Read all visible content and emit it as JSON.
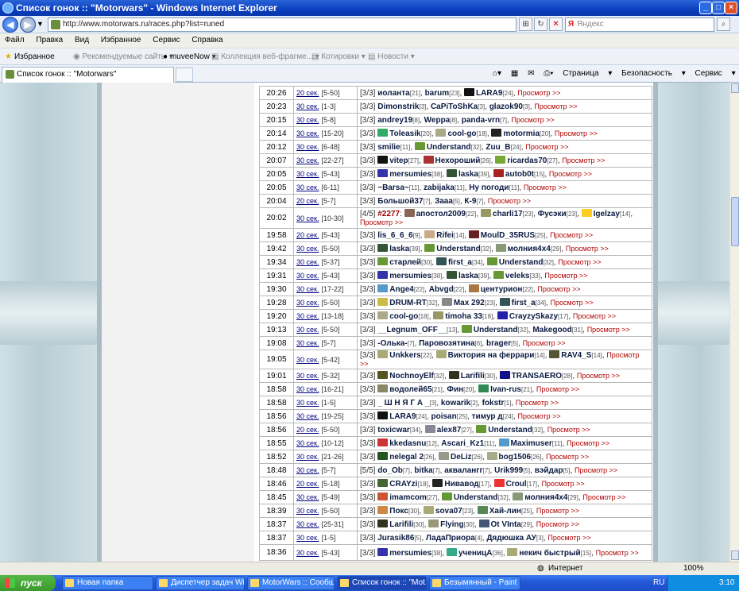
{
  "window": {
    "title": "Список гонок :: \"Motorwars\" - Windows Internet Explorer"
  },
  "address": {
    "url": "http://www.motorwars.ru/races.php?list=runed",
    "search_placeholder": "Яндекс"
  },
  "menu": [
    "Файл",
    "Правка",
    "Вид",
    "Избранное",
    "Сервис",
    "Справка"
  ],
  "favorites": {
    "label": "Избранное",
    "items": [
      "Рекомендуемые сайты",
      "muveeNow",
      "Коллекция веб-фрагме...",
      "Котировки",
      "Новости"
    ]
  },
  "tab": {
    "title": "Список гонок :: \"Motorwars\""
  },
  "commands": [
    "Страница",
    "Безопасность",
    "Сервис"
  ],
  "races": [
    {
      "t": "20:26",
      "d": "20 сек.",
      "r": "[5-50]",
      "p": [
        [
          "иоланта",
          "21",
          ""
        ],
        [
          "barum",
          "23",
          ""
        ],
        [
          "LARA9",
          "24",
          "#111"
        ]
      ]
    },
    {
      "t": "20:23",
      "d": "30 сек.",
      "r": "[1-3]",
      "p": [
        [
          "Dimonstrik",
          "3",
          ""
        ],
        [
          "CaPiToShKa",
          "3",
          ""
        ],
        [
          "glazok90",
          "3",
          ""
        ]
      ]
    },
    {
      "t": "20:15",
      "d": "30 сек.",
      "r": "[5-8]",
      "p": [
        [
          "andrey19",
          "8",
          ""
        ],
        [
          "Weppa",
          "8",
          ""
        ],
        [
          "panda-vrn",
          "7",
          ""
        ]
      ]
    },
    {
      "t": "20:14",
      "d": "30 сек.",
      "r": "[15-20]",
      "p": [
        [
          "Toleasik",
          "20",
          "#3a6"
        ],
        [
          "cool-go",
          "18",
          "#aa8"
        ],
        [
          "motormia",
          "20",
          "#222"
        ]
      ]
    },
    {
      "t": "20:12",
      "d": "30 сек.",
      "r": "[6-48]",
      "p": [
        [
          "smilie",
          "11",
          ""
        ],
        [
          "Understand",
          "32",
          "#693"
        ],
        [
          "Zuu_B",
          "24",
          ""
        ]
      ]
    },
    {
      "t": "20:07",
      "d": "30 сек.",
      "r": "[22-27]",
      "p": [
        [
          "vitep",
          "27",
          "#111"
        ],
        [
          "Нехороший",
          "26",
          "#a33"
        ],
        [
          "ricardas70",
          "27",
          "#7a3"
        ]
      ]
    },
    {
      "t": "20:05",
      "d": "30 сек.",
      "r": "[5-43]",
      "p": [
        [
          "mersumies",
          "38",
          "#33a"
        ],
        [
          "laska",
          "39",
          "#353"
        ],
        [
          "autob0t",
          "15",
          "#a22"
        ]
      ]
    },
    {
      "t": "20:05",
      "d": "30 сек.",
      "r": "[6-11]",
      "p": [
        [
          "~Barsa~",
          "11",
          ""
        ],
        [
          "zabijaka",
          "11",
          ""
        ],
        [
          "Ну погоди",
          "11",
          ""
        ]
      ]
    },
    {
      "t": "20:04",
      "d": "20 сек.",
      "r": "[5-7]",
      "p": [
        [
          "Большой37",
          "7",
          ""
        ],
        [
          "Зааа",
          "5",
          ""
        ],
        [
          "К-9",
          "7",
          ""
        ]
      ]
    },
    {
      "t": "20:02",
      "d": "30 сек.",
      "r": "[10-30]",
      "x": "#2277",
      "q": "[4/5]",
      "p": [
        [
          "апостол2009",
          "22",
          "#865"
        ],
        [
          "charli17",
          "23",
          "#996"
        ],
        [
          "Фусэки",
          "23",
          ""
        ],
        [
          "Igelzay",
          "14",
          "#fc2"
        ]
      ]
    },
    {
      "t": "19:58",
      "d": "20 сек.",
      "r": "[5-43]",
      "p": [
        [
          "lis_6_6_6",
          "9",
          ""
        ],
        [
          "Rifei",
          "14",
          "#ca8"
        ],
        [
          "MoulD_35RUS",
          "25",
          "#622"
        ]
      ]
    },
    {
      "t": "19:42",
      "d": "30 сек.",
      "r": "[5-50]",
      "p": [
        [
          "laska",
          "39",
          "#353"
        ],
        [
          "Understand",
          "32",
          "#693"
        ],
        [
          "молния4х4",
          "29",
          "#897"
        ]
      ]
    },
    {
      "t": "19:34",
      "d": "30 сек.",
      "r": "[5-37]",
      "p": [
        [
          "старлей",
          "30",
          "#693"
        ],
        [
          "first_a",
          "34",
          "#355"
        ],
        [
          "Understand",
          "32",
          "#693"
        ]
      ]
    },
    {
      "t": "19:31",
      "d": "30 сек.",
      "r": "[5-43]",
      "p": [
        [
          "mersumies",
          "38",
          "#33a"
        ],
        [
          "laska",
          "39",
          "#353"
        ],
        [
          "veleks",
          "33",
          "#693"
        ]
      ]
    },
    {
      "t": "19:30",
      "d": "30 сек.",
      "r": "[17-22]",
      "p": [
        [
          "Ange4",
          "22",
          "#59c"
        ],
        [
          "Abvgd",
          "22",
          ""
        ],
        [
          "центурион",
          "22",
          "#a74"
        ]
      ]
    },
    {
      "t": "19:28",
      "d": "30 сек.",
      "r": "[5-50]",
      "p": [
        [
          "DRUM-RT",
          "32",
          "#cb4"
        ],
        [
          "Max 292",
          "23",
          "#888"
        ],
        [
          "first_a",
          "34",
          "#355"
        ]
      ]
    },
    {
      "t": "19:20",
      "d": "30 сек.",
      "r": "[13-18]",
      "p": [
        [
          "cool-go",
          "18",
          "#aa8"
        ],
        [
          "timoha 33",
          "18",
          "#996"
        ],
        [
          "CrayzySkazy",
          "17",
          "#22a"
        ]
      ]
    },
    {
      "t": "19:13",
      "d": "30 сек.",
      "r": "[5-50]",
      "p": [
        [
          "__Legnum_OFF__",
          "13",
          ""
        ],
        [
          "Understand",
          "32",
          "#693"
        ],
        [
          "Makegood",
          "31",
          ""
        ]
      ]
    },
    {
      "t": "19:08",
      "d": "30 сек.",
      "r": "[5-7]",
      "p": [
        [
          "-Олька-",
          "7",
          ""
        ],
        [
          "Паровозятина",
          "6",
          ""
        ],
        [
          "brager",
          "5",
          ""
        ]
      ]
    },
    {
      "t": "19:05",
      "d": "30 сек.",
      "r": "[5-42]",
      "p": [
        [
          "Unkkers",
          "22",
          "#aa7"
        ],
        [
          "Виктория на феррари",
          "14",
          "#aa7"
        ],
        [
          "RAV4_S",
          "14",
          "#553"
        ]
      ]
    },
    {
      "t": "19:01",
      "d": "30 сек.",
      "r": "[5-32]",
      "p": [
        [
          "NochnoyElf",
          "32",
          "#552"
        ],
        [
          "Larifili",
          "30",
          "#332"
        ],
        [
          "TRANSAERO",
          "28",
          "#118"
        ]
      ]
    },
    {
      "t": "18:58",
      "d": "30 сек.",
      "r": "[16-21]",
      "p": [
        [
          "водолей65",
          "21",
          "#886"
        ],
        [
          "Фин",
          "20",
          ""
        ],
        [
          "Ivan-rus",
          "21",
          "#385"
        ]
      ]
    },
    {
      "t": "18:58",
      "d": "30 сек.",
      "r": "[1-5]",
      "p": [
        [
          "_ Ш Н Я Г А _",
          "3",
          ""
        ],
        [
          "kowarik",
          "2",
          ""
        ],
        [
          "fokstr",
          "1",
          ""
        ]
      ]
    },
    {
      "t": "18:56",
      "d": "30 сек.",
      "r": "[19-25]",
      "p": [
        [
          "LARA9",
          "24",
          "#111"
        ],
        [
          "poisan",
          "25",
          ""
        ],
        [
          "тимур д",
          "24",
          ""
        ]
      ]
    },
    {
      "t": "18:56",
      "d": "20 сек.",
      "r": "[5-50]",
      "p": [
        [
          "toxicwar",
          "34",
          ""
        ],
        [
          "alex87",
          "27",
          "#889"
        ],
        [
          "Understand",
          "32",
          "#693"
        ]
      ]
    },
    {
      "t": "18:55",
      "d": "30 сек.",
      "r": "[10-12]",
      "p": [
        [
          "kkedasnu",
          "12",
          "#c33"
        ],
        [
          "Ascari_Kz1",
          "11",
          ""
        ],
        [
          "Maximuser",
          "11",
          "#59c"
        ]
      ]
    },
    {
      "t": "18:52",
      "d": "30 сек.",
      "r": "[21-26]",
      "p": [
        [
          "nelegal 2",
          "26",
          "#252"
        ],
        [
          "DeLiz",
          "26",
          "#998"
        ],
        [
          "bog1506",
          "26",
          "#aa8"
        ]
      ]
    },
    {
      "t": "18:48",
      "d": "30 сек.",
      "r": "[5-7]",
      "q": "[5/5]",
      "p": [
        [
          "do_Ob",
          "7",
          ""
        ],
        [
          "bitka",
          "7",
          ""
        ],
        [
          "аквалангг",
          "7",
          ""
        ],
        [
          "Urik999",
          "5",
          ""
        ],
        [
          "вэйдар",
          "5",
          ""
        ]
      ]
    },
    {
      "t": "18:46",
      "d": "20 сек.",
      "r": "[5-18]",
      "p": [
        [
          "CRAYzi",
          "18",
          "#463"
        ],
        [
          "Нивавод",
          "17",
          "#222"
        ],
        [
          "Croul",
          "17",
          "#e33"
        ]
      ]
    },
    {
      "t": "18:45",
      "d": "30 сек.",
      "r": "[5-49]",
      "p": [
        [
          "imamcom",
          "27",
          "#c53"
        ],
        [
          "Understand",
          "32",
          "#693"
        ],
        [
          "молния4х4",
          "29",
          "#897"
        ]
      ]
    },
    {
      "t": "18:39",
      "d": "30 сек.",
      "r": "[5-50]",
      "p": [
        [
          "Покс",
          "30",
          "#c84"
        ],
        [
          "sova07",
          "23",
          "#aa7"
        ],
        [
          "Хай-лин",
          "25",
          "#585"
        ]
      ]
    },
    {
      "t": "18:37",
      "d": "30 сек.",
      "r": "[25-31]",
      "p": [
        [
          "Larifili",
          "30",
          "#332"
        ],
        [
          "Flying",
          "30",
          "#997"
        ],
        [
          "Ot VInta",
          "29",
          "#457"
        ]
      ]
    },
    {
      "t": "18:37",
      "d": "30 сек.",
      "r": "[1-5]",
      "p": [
        [
          "Jurasik86",
          "5",
          ""
        ],
        [
          "ЛадаПриора",
          "4",
          ""
        ],
        [
          "Дядюшка АУ",
          "3",
          ""
        ]
      ]
    },
    {
      "t": "18:36",
      "d": "30 сек.",
      "r": "[5-43]",
      "p": [
        [
          "mersumies",
          "38",
          "#33a"
        ],
        [
          "ученицА",
          "36",
          "#3a8"
        ],
        [
          "некич быстрый",
          "15",
          "#aa7"
        ]
      ]
    }
  ],
  "view_label": "Просмотр >>",
  "status": {
    "zone": "Интернет",
    "zoom": "100%"
  },
  "taskbar": {
    "start": "пуск",
    "items": [
      "Новая папка",
      "Диспетчер задач Wi...",
      "MotorWars :: Сообщ...",
      "Список гонок :: \"Mot...",
      "Безымянный - Paint"
    ],
    "lang": "RU",
    "clock": "3:10"
  }
}
